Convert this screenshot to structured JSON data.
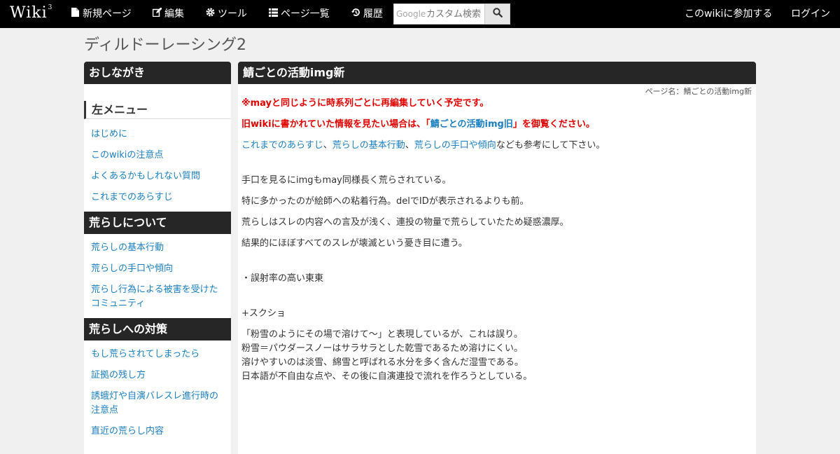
{
  "nav": {
    "logo": "Wiki",
    "logo_sup": "3",
    "items": [
      {
        "label": "新規ページ",
        "icon": "file-icon"
      },
      {
        "label": "編集",
        "icon": "edit-icon"
      },
      {
        "label": "ツール",
        "icon": "gear-icon"
      },
      {
        "label": "ページ一覧",
        "icon": "list-icon"
      },
      {
        "label": "履歴",
        "icon": "history-icon"
      }
    ],
    "search_prefix": "Google",
    "search_placeholder": "カスタム検索",
    "join": "このwikiに参加する",
    "login": "ログイン"
  },
  "page_title": "ディルドーレーシング2",
  "sidebar": {
    "head1": "おしながき",
    "sub1": "左メニュー",
    "links1": [
      "はじめに",
      "このwikiの注意点",
      "よくあるかもしれない質問",
      "これまでのあらすじ"
    ],
    "head2": "荒らしについて",
    "links2": [
      "荒らしの基本行動",
      "荒らしの手口や傾向",
      "荒らし行為による被害を受けたコミュニティ"
    ],
    "head3": "荒らしへの対策",
    "links3": [
      "もし荒らされてしまったら",
      "証拠の残し方",
      "誘蛾灯や自演バレスレ進行時の注意点",
      "直近の荒らし内容"
    ]
  },
  "main": {
    "title": "鯖ごとの活動img新",
    "page_name": "ページ名：鯖ごとの活動img新",
    "notice1": "※mayと同じように時系列ごとに再編集していく予定です。",
    "notice2_a": "旧wikiに書かれていた情報を見たい場合は、「",
    "notice2_link": "鯖ごとの活動img旧",
    "notice2_b": "」を御覧ください。",
    "ref_link1": "これまでのあらすじ",
    "ref_sep1": "、",
    "ref_link2": "荒らしの基本行動",
    "ref_sep2": "、",
    "ref_link3": "荒らしの手口や傾向",
    "ref_tail": "なども参考にして下さい。",
    "para1": "手口を見るにimgもmay同様長く荒らされている。",
    "para2": "特に多かったのが絵師への粘着行為。delでIDが表示されるよりも前。",
    "para3": "荒らしはスレの内容への言及が浅く、連投の物量で荒らしていたため疑惑濃厚。",
    "para4": "結果的にほぼすべてのスレが壊滅という憂き目に遭う。",
    "para5": "・誤射率の高い東東",
    "para6": "+スクショ",
    "para7_lines": [
      "「粉雪のようにその場で溶けて～」と表現しているが、これは誤り。",
      "粉雪＝パウダースノーはサラサラとした乾雪であるため溶けにくい。",
      "溶けやすいのは淡雪、綿雪と呼ばれる水分を多く含んだ湿雪である。",
      "日本語が不自由な点や、その後に自演連投で流れを作ろうとしている。"
    ]
  }
}
